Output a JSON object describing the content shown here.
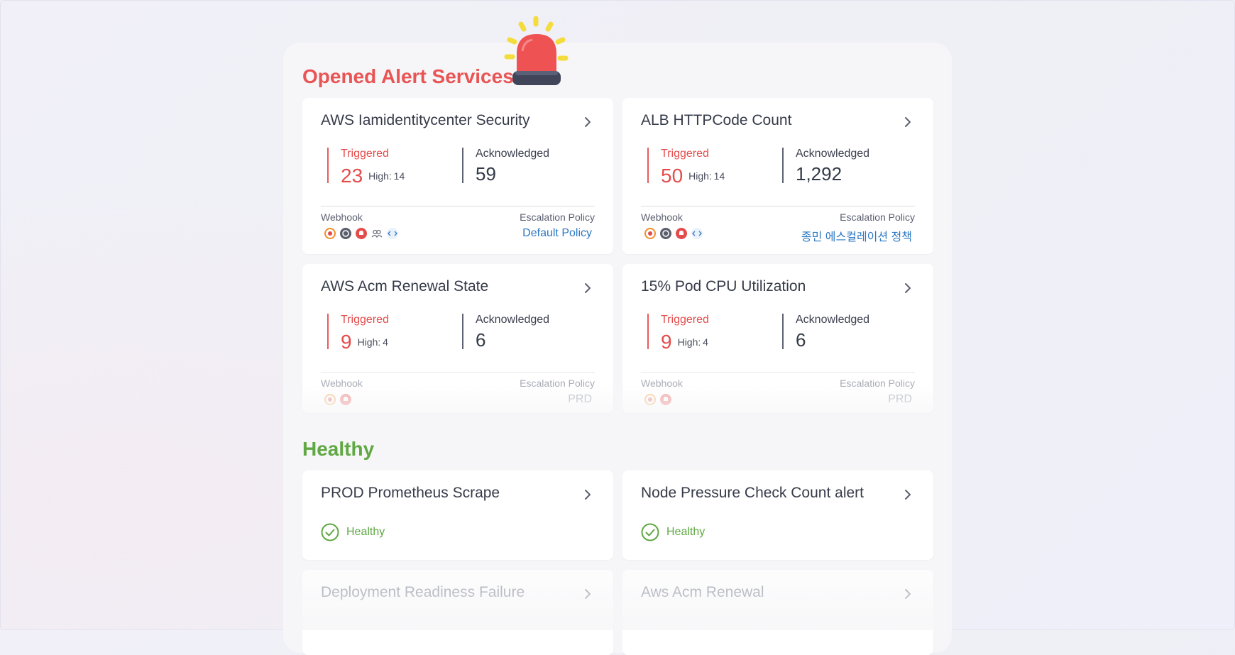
{
  "opened_section": {
    "title": "Opened Alert Services"
  },
  "healthy_section": {
    "title": "Healthy"
  },
  "labels": {
    "triggered": "Triggered",
    "acknowledged": "Acknowledged",
    "webhook": "Webhook",
    "escalation_policy": "Escalation Policy",
    "high_prefix": "High:"
  },
  "alert_cards": [
    {
      "name": "AWS Iamidentitycenter Security",
      "triggered": "23",
      "high": "14",
      "acknowledged": "59",
      "policy": "Default Policy",
      "webhooks": [
        "grafana-icon",
        "github-icon",
        "alert-bell-icon",
        "users-icon",
        "code-icon"
      ]
    },
    {
      "name": "ALB HTTPCode Count",
      "triggered": "50",
      "high": "14",
      "acknowledged": "1,292",
      "policy": "종민 에스컬레이션 정책",
      "webhooks": [
        "grafana-icon",
        "github-icon",
        "alert-bell-icon",
        "code-icon"
      ]
    },
    {
      "name": "AWS Acm Renewal State",
      "triggered": "9",
      "high": "4",
      "acknowledged": "6",
      "policy": "PRD",
      "webhooks": [
        "grafana-icon",
        "alert-bell-icon"
      ]
    },
    {
      "name": "15% Pod CPU Utilization",
      "triggered": "9",
      "high": "4",
      "acknowledged": "6",
      "policy": "PRD",
      "webhooks": [
        "grafana-icon",
        "alert-bell-icon"
      ]
    }
  ],
  "healthy_cards": [
    {
      "name": "PROD Prometheus Scrape",
      "status": "Healthy"
    },
    {
      "name": "Node Pressure Check Count alert",
      "status": "Healthy"
    },
    {
      "name": "Deployment Readiness Failure"
    },
    {
      "name": "Aws Acm Renewal"
    }
  ],
  "colors": {
    "alert": "#e95454",
    "healthy": "#5fa843",
    "link": "#2d78c2"
  }
}
